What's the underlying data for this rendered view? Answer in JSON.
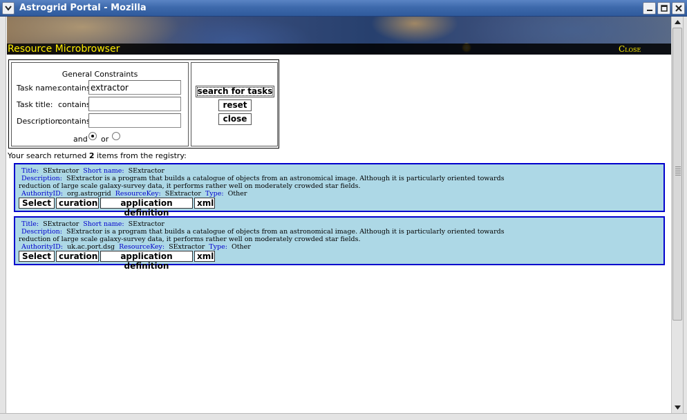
{
  "window": {
    "title": "Astrogrid Portal - Mozilla",
    "icons": [
      "chevron-down-icon",
      "minimize-icon",
      "maximize-icon",
      "close-icon"
    ]
  },
  "banner": {
    "title": "Resource Microbrowser",
    "close_label": "Close",
    "text_color": "#ffee00"
  },
  "form": {
    "section_title": "General Constraints",
    "rows": [
      {
        "label": "Task name:",
        "operator": "contains",
        "value": "extractor"
      },
      {
        "label": "Task title:",
        "operator": "contains",
        "value": ""
      },
      {
        "label": "Description:",
        "operator": "contains",
        "value": ""
      }
    ],
    "and_label": "and",
    "or_label": "or",
    "selected_logic": "and",
    "buttons": {
      "search": "search for tasks",
      "reset": "reset",
      "close": "close"
    }
  },
  "results": {
    "summary_prefix": "Your search returned ",
    "count": "2",
    "summary_suffix": " items from the registry:",
    "labels": {
      "title": "Title:",
      "short_name": "Short name:",
      "description": "Description:",
      "authority_id": "AuthorityID:",
      "resource_key": "ResourceKey:",
      "type": "Type:"
    },
    "buttons": {
      "select": "Select",
      "curation": "curation",
      "app_def": "application definition",
      "xml": "xml"
    },
    "items": [
      {
        "title": "SExtractor",
        "short_name": "SExtractor",
        "description_line1": "SExtractor is a program that builds a catalogue of objects from an astronomical image. Although it is particularly oriented towards",
        "description_line2": "reduction of large scale galaxy-survey data, it performs rather well on moderately crowded star fields.",
        "authority_id": "org.astrogrid",
        "resource_key": "SExtractor",
        "type": "Other"
      },
      {
        "title": "SExtractor",
        "short_name": "SExtractor",
        "description_line1": "SExtractor is a program that builds a catalogue of objects from an astronomical image. Although it is particularly oriented towards",
        "description_line2": "reduction of large scale galaxy-survey data, it performs rather well on moderately crowded star fields.",
        "authority_id": "uk.ac.port.dsg",
        "resource_key": "SExtractor",
        "type": "Other"
      }
    ]
  },
  "colors": {
    "card_background": "#add8e6",
    "card_border": "#0000cc",
    "label_blue": "#0000cc",
    "titlebar": "#3e6aac"
  }
}
